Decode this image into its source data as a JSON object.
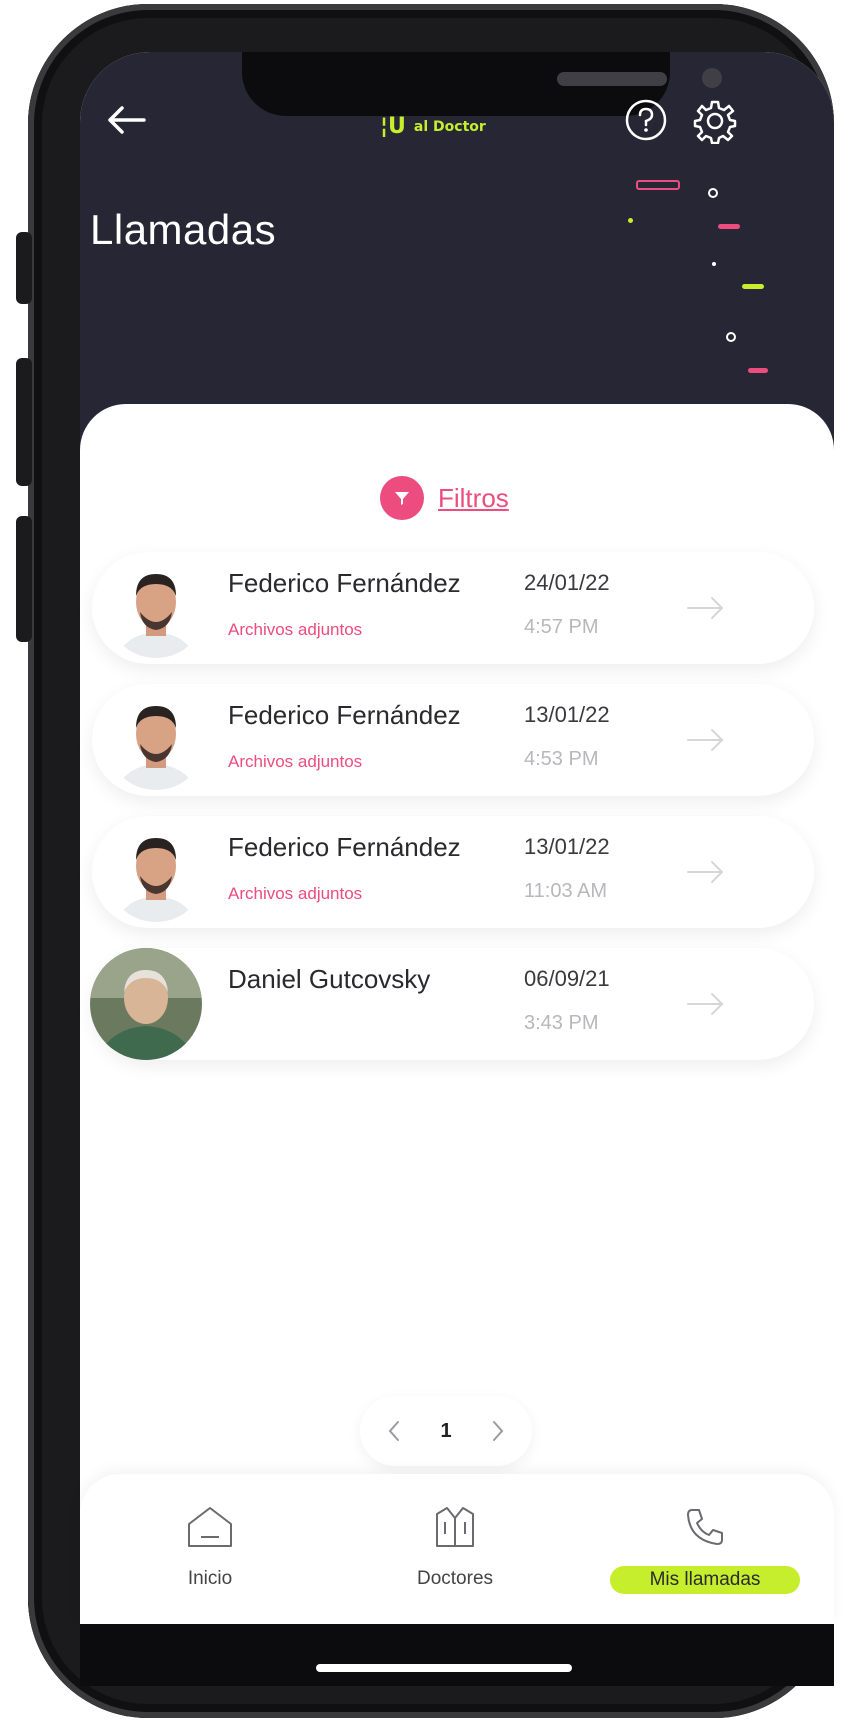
{
  "header": {
    "brand_text": "al Doctor",
    "title": "Llamadas",
    "colors": {
      "header_bg": "#272634",
      "accent_green": "#c6ee2c",
      "accent_pink": "#ec4c7e"
    },
    "icons": {
      "back": "arrow-left-icon",
      "help": "question-circle-icon",
      "settings": "gear-icon"
    }
  },
  "filters": {
    "label": "Filtros",
    "icon": "filter-funnel-icon"
  },
  "calls": [
    {
      "doctor": "Federico Fernández",
      "attachments": "Archivos adjuntos",
      "date": "24/01/22",
      "time": "4:57 PM"
    },
    {
      "doctor": "Federico Fernández",
      "attachments": "Archivos adjuntos",
      "date": "13/01/22",
      "time": "4:53 PM"
    },
    {
      "doctor": "Federico Fernández",
      "attachments": "Archivos adjuntos",
      "date": "13/01/22",
      "time": "11:03 AM"
    },
    {
      "doctor": "Daniel Gutcovsky",
      "attachments": "",
      "date": "06/09/21",
      "time": "3:43 PM"
    }
  ],
  "pagination": {
    "current_page": "1"
  },
  "bottom_nav": [
    {
      "label": "Inicio",
      "icon": "home-icon",
      "active": false
    },
    {
      "label": "Doctores",
      "icon": "doctor-coat-icon",
      "active": false
    },
    {
      "label": "Mis llamadas",
      "icon": "phone-icon",
      "active": true
    }
  ]
}
